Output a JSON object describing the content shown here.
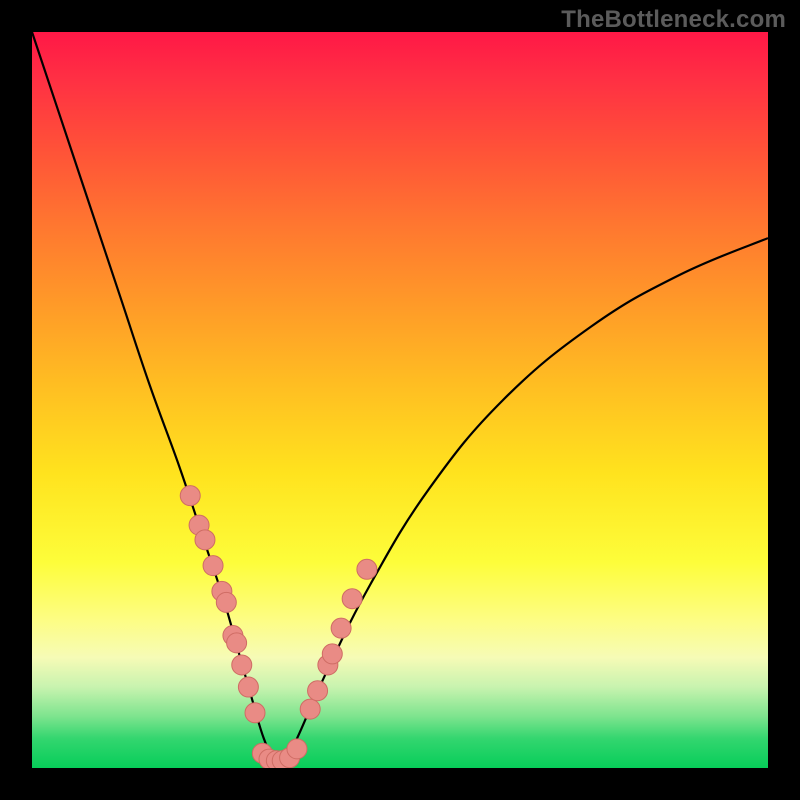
{
  "watermark": "TheBottleneck.com",
  "colors": {
    "curve": "#000000",
    "marker_fill": "#e98b85",
    "marker_stroke": "#cf6c64",
    "frame": "#000000"
  },
  "chart_data": {
    "type": "line",
    "title": "",
    "xlabel": "",
    "ylabel": "",
    "xlim": [
      0,
      100
    ],
    "ylim": [
      0,
      100
    ],
    "grid": false,
    "legend": false,
    "series": [
      {
        "name": "bottleneck-curve",
        "x": [
          0,
          4,
          8,
          12,
          16,
          20,
          23,
          26,
          28,
          30,
          31.5,
          33,
          34.3,
          36,
          40,
          46,
          54,
          64,
          76,
          88,
          100
        ],
        "y": [
          100,
          88,
          76,
          64,
          52,
          41,
          32,
          23,
          16,
          9,
          4,
          1,
          1,
          4,
          13,
          25,
          38,
          50,
          60,
          67,
          72
        ]
      }
    ],
    "markers": [
      {
        "name": "left-cluster",
        "points": [
          {
            "x": 21.5,
            "y": 37
          },
          {
            "x": 22.7,
            "y": 33
          },
          {
            "x": 23.5,
            "y": 31
          },
          {
            "x": 24.6,
            "y": 27.5
          },
          {
            "x": 25.8,
            "y": 24
          },
          {
            "x": 26.4,
            "y": 22.5
          },
          {
            "x": 27.3,
            "y": 18
          },
          {
            "x": 27.8,
            "y": 17
          },
          {
            "x": 28.5,
            "y": 14
          },
          {
            "x": 29.4,
            "y": 11
          },
          {
            "x": 30.3,
            "y": 7.5
          }
        ]
      },
      {
        "name": "bottom-cluster",
        "points": [
          {
            "x": 31.3,
            "y": 2.0
          },
          {
            "x": 32.2,
            "y": 1.2
          },
          {
            "x": 33.2,
            "y": 1.0
          },
          {
            "x": 34.0,
            "y": 1.0
          },
          {
            "x": 35.0,
            "y": 1.4
          },
          {
            "x": 36.0,
            "y": 2.6
          }
        ]
      },
      {
        "name": "right-cluster",
        "points": [
          {
            "x": 37.8,
            "y": 8
          },
          {
            "x": 38.8,
            "y": 10.5
          },
          {
            "x": 40.2,
            "y": 14
          },
          {
            "x": 40.8,
            "y": 15.5
          },
          {
            "x": 42.0,
            "y": 19
          },
          {
            "x": 43.5,
            "y": 23
          },
          {
            "x": 45.5,
            "y": 27
          }
        ]
      }
    ],
    "marker_radius_px": 10
  }
}
